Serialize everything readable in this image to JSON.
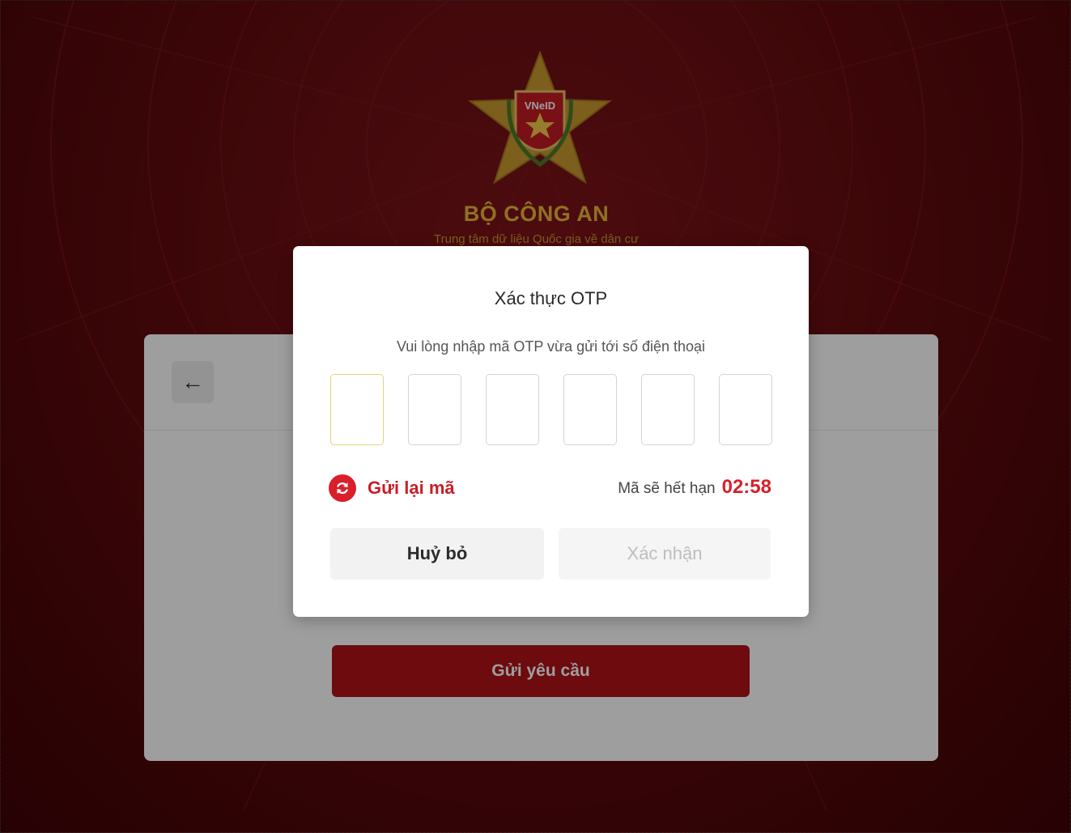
{
  "header": {
    "logo_text": "VNeID",
    "org_title": "BỘ CÔNG AN",
    "org_subtitle": "Trung tâm dữ liệu Quốc gia về dân cư"
  },
  "background_card": {
    "submit_label": "Gửi yêu cầu"
  },
  "otp_modal": {
    "title": "Xác thực OTP",
    "description": "Vui lòng nhập mã OTP vừa gửi tới số điện thoại",
    "digits": [
      "",
      "",
      "",
      "",
      "",
      ""
    ],
    "resend_label": "Gửi lại mã",
    "expiry_label": "Mã sẽ hết hạn",
    "expiry_timer": "02:58",
    "cancel_label": "Huỷ bỏ",
    "confirm_label": "Xác nhận"
  },
  "colors": {
    "brand_red": "#b01219",
    "accent_red": "#d81f2a",
    "gold": "#e8b63a"
  },
  "icons": {
    "back": "arrow-left-icon",
    "resend": "refresh-icon",
    "emblem": "police-star-emblem"
  }
}
